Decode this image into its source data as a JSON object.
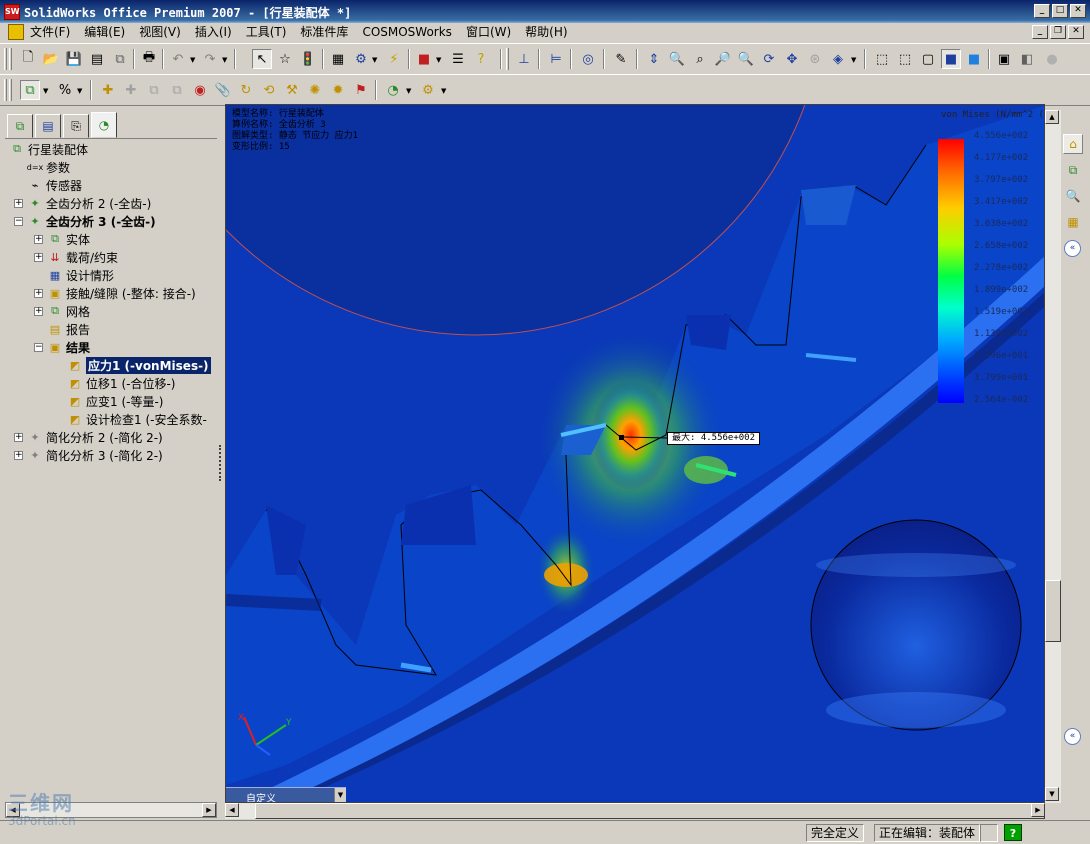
{
  "window": {
    "title": "SolidWorks Office Premium 2007 - [行星装配体 *]",
    "app_icon_text": "SW"
  },
  "menu": {
    "items": [
      "文件(F)",
      "编辑(E)",
      "视图(V)",
      "插入(I)",
      "工具(T)",
      "标准件库",
      "COSMOSWorks",
      "窗口(W)",
      "帮助(H)"
    ]
  },
  "tree": {
    "root": "行星装配体",
    "items": [
      {
        "label": "参数",
        "icon": "parameters-icon"
      },
      {
        "label": "传感器",
        "icon": "sensor-icon"
      },
      {
        "label": "全齿分析 2 (-全齿-)",
        "icon": "study-icon"
      },
      {
        "label": "全齿分析 3 (-全齿-)",
        "icon": "study-icon"
      },
      {
        "label": "实体",
        "icon": "solid-body-icon"
      },
      {
        "label": "载荷/约束",
        "icon": "load-restraint-icon"
      },
      {
        "label": "设计情形",
        "icon": "design-scenario-icon"
      },
      {
        "label": "接触/缝隙 (-整体: 接合-)",
        "icon": "contact-icon"
      },
      {
        "label": "网格",
        "icon": "mesh-icon"
      },
      {
        "label": "报告",
        "icon": "report-icon"
      },
      {
        "label": "结果",
        "icon": "results-folder-icon"
      },
      {
        "label": "应力1 (-vonMises-)",
        "icon": "plot-icon"
      },
      {
        "label": "位移1 (-合位移-)",
        "icon": "plot-icon"
      },
      {
        "label": "应变1 (-等量-)",
        "icon": "plot-icon"
      },
      {
        "label": "设计检查1 (-安全系数-",
        "icon": "plot-icon"
      },
      {
        "label": "简化分析 2 (-简化 2-)",
        "icon": "study-icon"
      },
      {
        "label": "简化分析 3 (-简化 2-)",
        "icon": "study-icon"
      }
    ]
  },
  "viewport": {
    "info_lines": [
      "模型名称: 行星装配体",
      "算例名称: 全齿分析 3",
      "图解类型: 静态 节应力 应力1",
      "变形比例: 15"
    ],
    "legend_title": "von Mises (N/mm^2 (",
    "legend_values": [
      "4.556e+002",
      "4.177e+002",
      "3.797e+002",
      "3.417e+002",
      "3.038e+002",
      "2.658e+002",
      "2.278e+002",
      "1.899e+002",
      "1.519e+002",
      "1.139e+002",
      "7.596e+001",
      "3.799e+001",
      "2.564e-002"
    ],
    "max_callout": "最大: 4.556e+002",
    "orientation_label": "自定义"
  },
  "status": {
    "fully_defined": "完全定义",
    "editing": "正在编辑：装配体",
    "help": "?"
  },
  "watermark": {
    "logo_text": "三维网",
    "site_text": "3dPortal.cn"
  },
  "colors": {
    "title_bar": "#0a246a",
    "selection": "#0a246a",
    "viewport_bg": "#0a3fbf"
  }
}
